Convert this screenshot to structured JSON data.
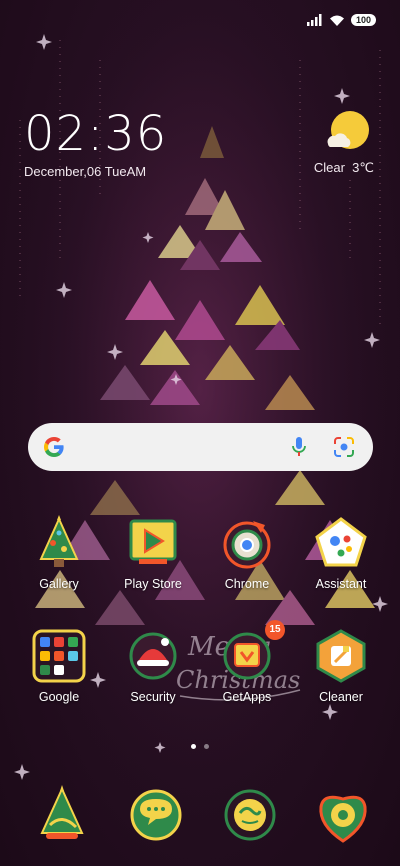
{
  "status_bar": {
    "battery": "100",
    "signal_icon": "signal-icon",
    "wifi_icon": "wifi-icon"
  },
  "clock": {
    "time": "02:36",
    "date": "December,06 TueAM"
  },
  "weather": {
    "condition": "Clear",
    "temperature": "3℃",
    "icon": "sun-cloud-icon"
  },
  "search": {
    "placeholder": "",
    "google_icon": "google-logo-icon",
    "mic_icon": "mic-icon",
    "lens_icon": "lens-icon"
  },
  "apps_row1": [
    {
      "label": "Gallery",
      "icon": "gallery-icon"
    },
    {
      "label": "Play Store",
      "icon": "play-store-icon"
    },
    {
      "label": "Chrome",
      "icon": "chrome-icon"
    },
    {
      "label": "Assistant",
      "icon": "assistant-icon"
    }
  ],
  "apps_row2": [
    {
      "label": "Google",
      "icon": "google-folder-icon"
    },
    {
      "label": "Security",
      "icon": "security-icon"
    },
    {
      "label": "GetApps",
      "icon": "getapps-icon",
      "badge": "15"
    },
    {
      "label": "Cleaner",
      "icon": "cleaner-icon"
    }
  ],
  "wallpaper_text": "Merry Christmas",
  "page_indicator": {
    "pages": 2,
    "active": 1
  },
  "dock": [
    {
      "icon": "phone-icon"
    },
    {
      "icon": "messages-icon"
    },
    {
      "icon": "browser-icon"
    },
    {
      "icon": "camera-icon"
    }
  ],
  "colors": {
    "background": "#260f22",
    "accent_yellow": "#f3d34a",
    "badge": "#f2562a",
    "search_bg": "#f1f1f1"
  }
}
